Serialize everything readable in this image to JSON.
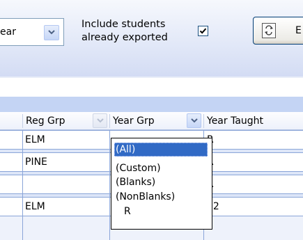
{
  "filter_bar": {
    "year_select_value": "ear",
    "include_label_line1": "Include students",
    "include_label_line2": "already exported",
    "include_checked": true,
    "export_button_partial_label": "E"
  },
  "grid": {
    "columns": {
      "reg_grp": "Reg Grp",
      "year_grp": "Year Grp",
      "year_taught": "Year Taught"
    },
    "rows": [
      {
        "reg_grp": "ELM",
        "year_taught": "R"
      },
      {
        "reg_grp": "PINE",
        "year_taught": "R"
      },
      {
        "reg_grp": "",
        "year_taught": "R"
      },
      {
        "reg_grp": "ELM",
        "year_taught": "12"
      }
    ]
  },
  "year_grp_filter": {
    "options": [
      "(All)",
      "(Custom)",
      "(Blanks)",
      "(NonBlanks)",
      "R"
    ],
    "selected": "(All)"
  },
  "colors": {
    "header_band": "#d3dcf4",
    "group_band": "#c4d4f4",
    "selection": "#316ac5",
    "grid_line": "#8aa5d8"
  }
}
